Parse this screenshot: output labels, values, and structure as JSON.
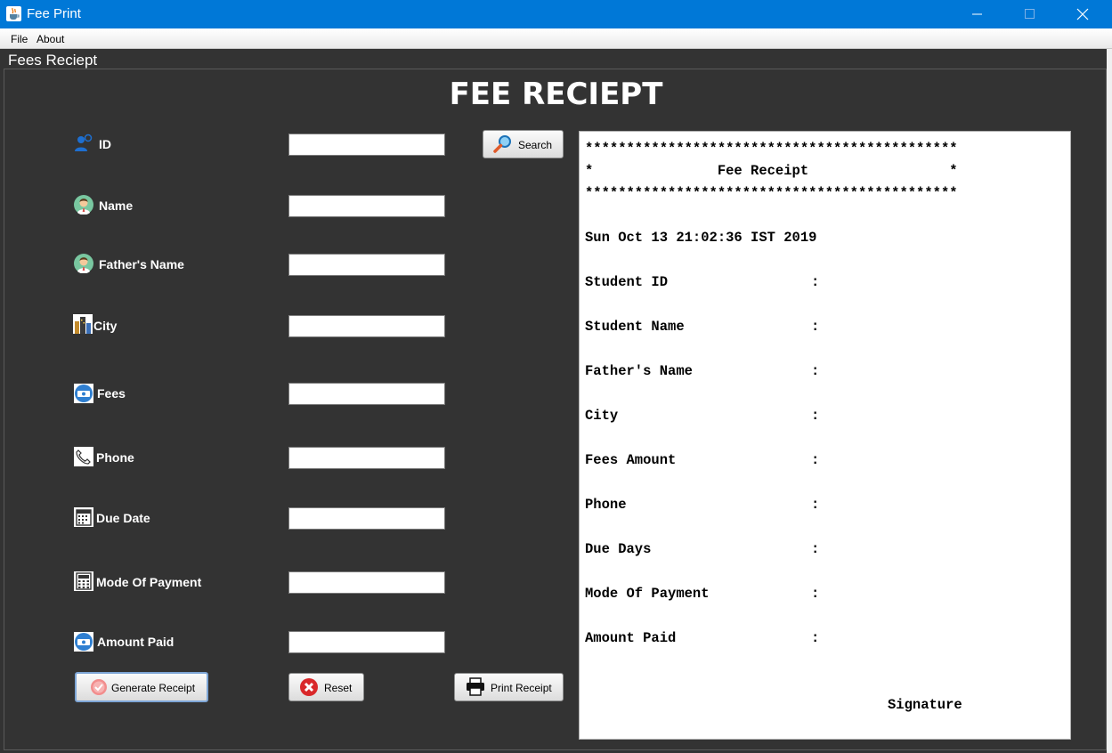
{
  "window": {
    "title": "Fee Print",
    "icon": "java-cup-icon"
  },
  "menu": [
    "File",
    "About"
  ],
  "panel_title": "Fees Reciept",
  "heading": "FEE RECIEPT",
  "form": {
    "fields": [
      {
        "label": "ID",
        "icon": "user-id-icon",
        "value": ""
      },
      {
        "label": "Name",
        "icon": "person-avatar-icon",
        "value": ""
      },
      {
        "label": "Father's Name",
        "icon": "person-avatar-icon",
        "value": ""
      },
      {
        "label": "City",
        "icon": "city-icon",
        "value": ""
      },
      {
        "label": "Fees",
        "icon": "money-icon",
        "value": ""
      },
      {
        "label": "Phone",
        "icon": "phone-icon",
        "value": ""
      },
      {
        "label": "Due Date",
        "icon": "calendar-icon",
        "value": ""
      },
      {
        "label": "Mode Of Payment",
        "icon": "calculator-icon",
        "value": ""
      },
      {
        "label": "Amount Paid",
        "icon": "money-icon",
        "value": ""
      }
    ]
  },
  "buttons": {
    "search": "Search",
    "generate": "Generate Receipt",
    "reset": "Reset",
    "print": "Print Receipt"
  },
  "receipt": {
    "border_line": "*********************************************",
    "header_line": "*               Fee Receipt                 *",
    "date": "Sun Oct 13 21:02:36 IST 2019",
    "rows": [
      {
        "key": "Student ID",
        "sep": ":"
      },
      {
        "key": "Student Name",
        "sep": ":"
      },
      {
        "key": "Father's Name",
        "sep": ":"
      },
      {
        "key": "City",
        "sep": ":"
      },
      {
        "key": "Fees Amount",
        "sep": ":"
      },
      {
        "key": "Phone",
        "sep": ":"
      },
      {
        "key": "Due Days",
        "sep": ":"
      },
      {
        "key": "Mode Of Payment",
        "sep": ":"
      },
      {
        "key": "Amount Paid",
        "sep": ":"
      }
    ],
    "signature": "Signature"
  },
  "colors": {
    "titlebar": "#0078d7",
    "background": "#333333",
    "text": "#ffffff"
  }
}
